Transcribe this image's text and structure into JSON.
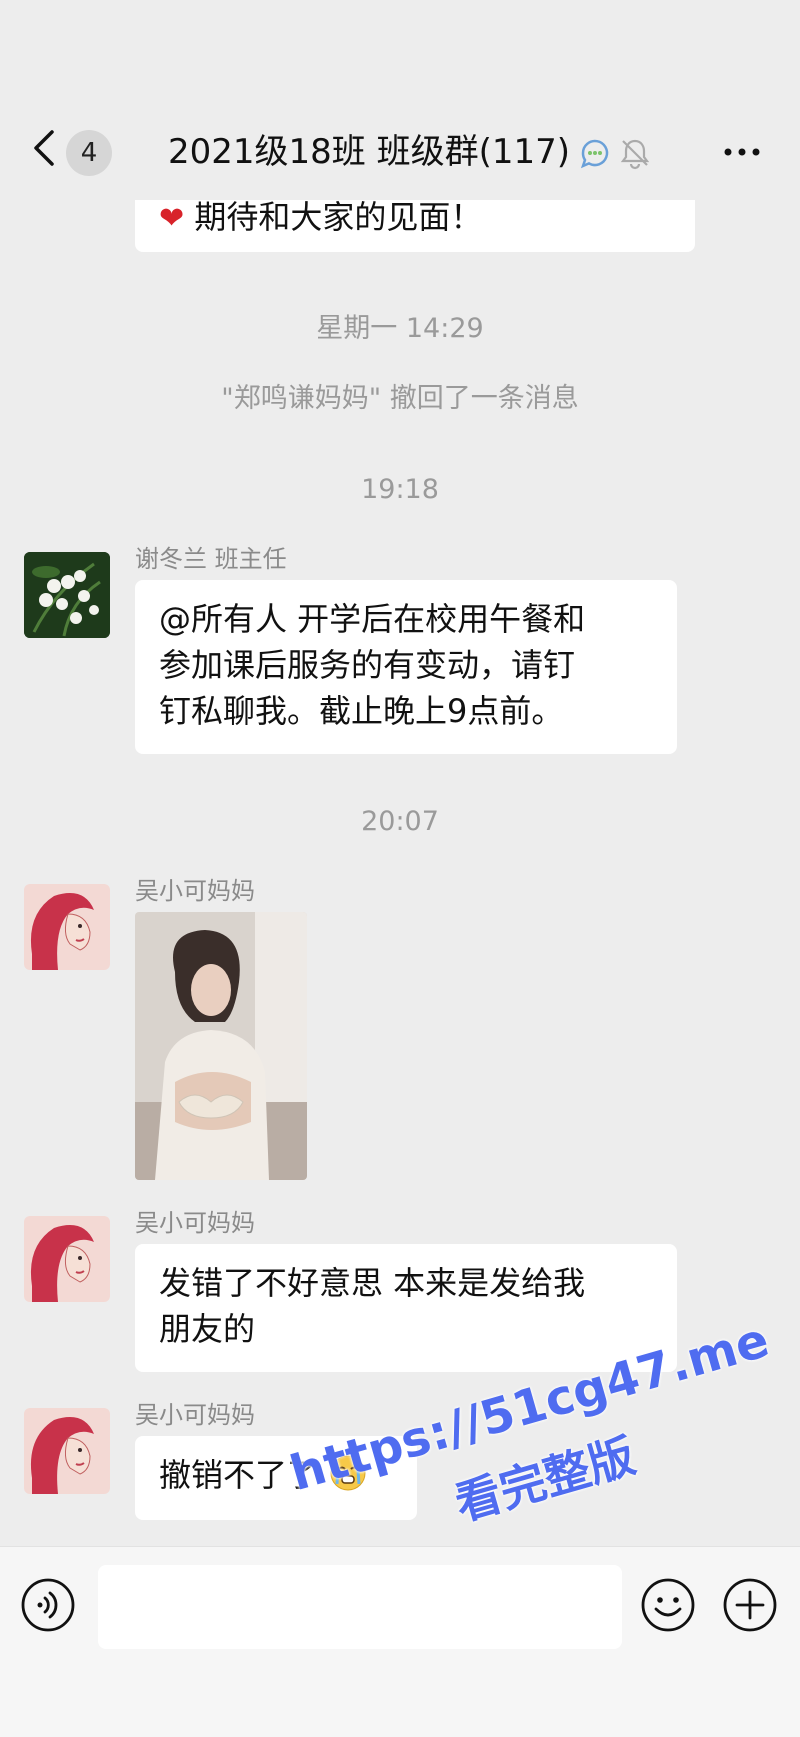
{
  "header": {
    "back_badge": "4",
    "title": "2021级18班 班级群(117)",
    "icons": [
      "back-chevron-icon",
      "chat-loading-icon",
      "mute-bell-icon",
      "more-dots-icon"
    ]
  },
  "messages": {
    "top_partial": "期待和大家的见面！",
    "ts1": "星期一 14:29",
    "recall_notice": "\"郑鸣谦妈妈\" 撤回了一条消息",
    "ts2": "19:18",
    "msg1": {
      "sender": "谢冬兰 班主任",
      "lines": [
        "@所有人 开学后在校用午餐和",
        "参加课后服务的有变动，请钉",
        "钉私聊我。截止晚上9点前。"
      ]
    },
    "ts3": "20:07",
    "msg2": {
      "sender": "吴小可妈妈"
    },
    "msg3": {
      "sender": "吴小可妈妈",
      "lines": [
        "发错了不好意思 本来是发给我",
        "朋友的"
      ]
    },
    "msg4": {
      "sender": "吴小可妈妈",
      "text": "撤销不了了"
    }
  },
  "watermark": {
    "line1": "https://51cg47.me",
    "line2": "看完整版"
  },
  "colors": {
    "background": "#ededed",
    "bubble": "#ffffff",
    "muted": "#9a9a9a",
    "watermark": "#4f6cf0"
  }
}
